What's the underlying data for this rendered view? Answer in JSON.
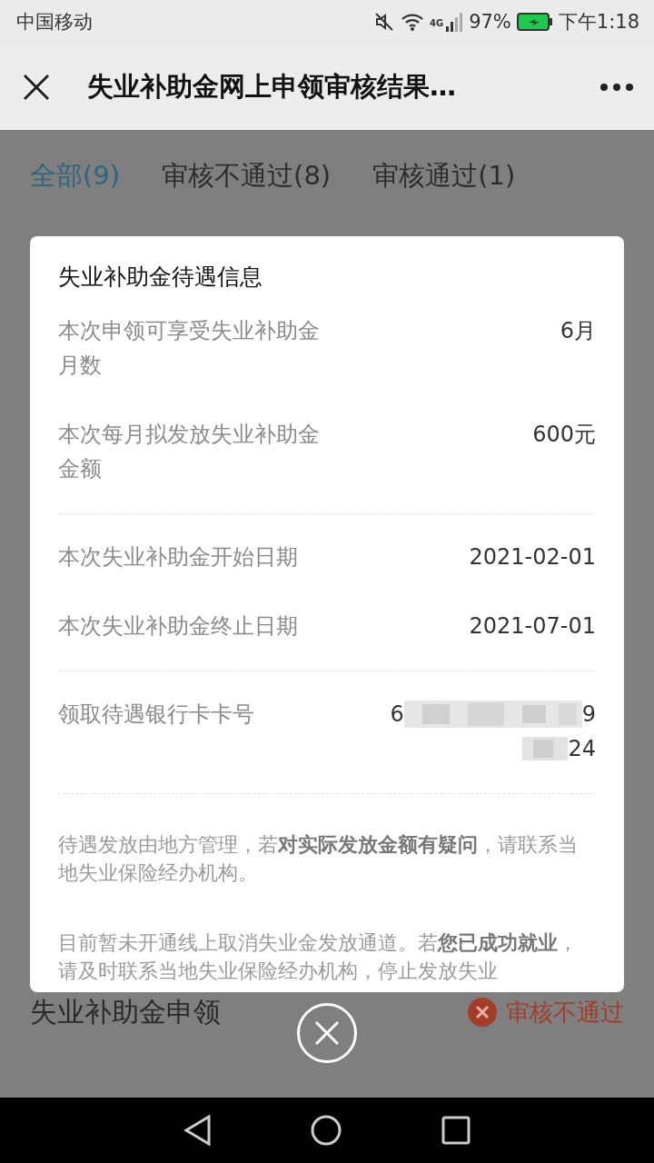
{
  "status_bar": {
    "carrier": "中国移动",
    "network": "4G",
    "battery": "97%",
    "time": "下午1:18"
  },
  "header": {
    "title": "失业补助金网上申领审核结果…"
  },
  "tabs": [
    {
      "label": "全部(9)",
      "selected": true
    },
    {
      "label": "审核不通过(8)",
      "selected": false
    },
    {
      "label": "审核通过(1)",
      "selected": false
    }
  ],
  "dialog": {
    "title": "失业补助金待遇信息",
    "groups": [
      {
        "rows": [
          {
            "kind": "text",
            "label": "本次申领可享受失业补助金月数",
            "value": "6月"
          },
          {
            "kind": "text",
            "label": "本次每月拟发放失业补助金金额",
            "value": "600元"
          }
        ]
      },
      {
        "rows": [
          {
            "kind": "text",
            "label": "本次失业补助金开始日期",
            "value": "2021-02-01"
          },
          {
            "kind": "text",
            "label": "本次失业补助金终止日期",
            "value": "2021-07-01"
          }
        ]
      },
      {
        "rows": [
          {
            "kind": "masked",
            "label": "领取待遇银行卡卡号",
            "line_1_start": "6",
            "line_1_end": "9",
            "line_2_end": "24"
          }
        ]
      }
    ],
    "notes": [
      "待遇发放由地方管理，若**对实际发放金额有疑问**，请联系当地失业保险经办机构。",
      "目前暂未开通线上取消失业金发放通道。若**您已成功就业**，请及时联系当地失业保险经办机构，停止发放失业"
    ]
  },
  "background_list": {
    "title": "失业补助金申领",
    "status": "审核不通过"
  }
}
